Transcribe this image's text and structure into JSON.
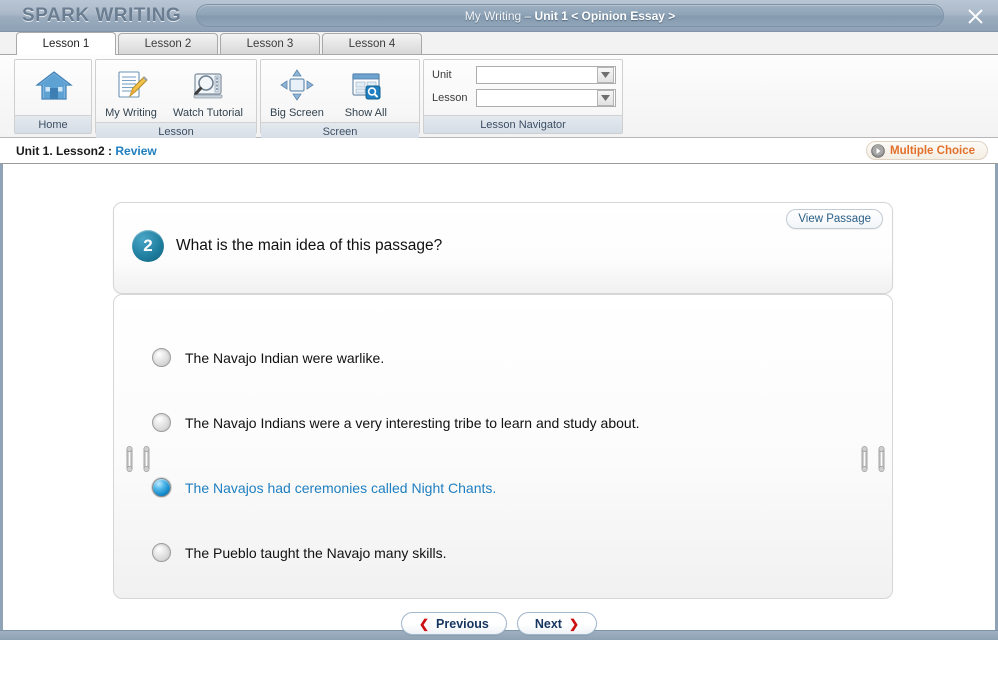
{
  "titlebar": {
    "brand": "SPARK WRITING",
    "title_prefix": "My Writing",
    "title_separator": "–",
    "title_main": "Unit 1 < Opinion Essay >",
    "close_icon": "close-icon"
  },
  "tabs": [
    {
      "label": "Lesson 1",
      "active": true
    },
    {
      "label": "Lesson 2",
      "active": false
    },
    {
      "label": "Lesson 3",
      "active": false
    },
    {
      "label": "Lesson 4",
      "active": false
    }
  ],
  "ribbon": {
    "groups": [
      {
        "label": "Home",
        "commands": [
          {
            "caption": "Home",
            "icon": "house-icon"
          }
        ]
      },
      {
        "label": "Lesson",
        "commands": [
          {
            "caption": "My Writing",
            "icon": "document-pencil-icon"
          },
          {
            "caption": "Watch Tutorial",
            "icon": "video-magnifier-icon"
          }
        ]
      },
      {
        "label": "Screen",
        "commands": [
          {
            "caption": "Big Screen",
            "icon": "resize-arrows-icon"
          },
          {
            "caption": "Show All",
            "icon": "window-search-icon"
          }
        ]
      },
      {
        "label": "Lesson Navigator",
        "selects": [
          {
            "label": "Unit",
            "value": "",
            "placeholder": ""
          },
          {
            "label": "Lesson",
            "value": "",
            "placeholder": ""
          }
        ]
      }
    ]
  },
  "breadcrumb": {
    "path": "Unit 1. Lesson2 : ",
    "current": "Review",
    "badge_label": "Multiple Choice",
    "badge_icon": "arrow-circle-right-icon"
  },
  "question": {
    "number": "2",
    "text": "What is the main idea of this passage?",
    "view_passage_label": "View Passage"
  },
  "options": [
    {
      "text": "The Navajo Indian were warlike.",
      "selected": false
    },
    {
      "text": "The Navajo Indians were a very interesting tribe to learn and study about.",
      "selected": false
    },
    {
      "text": "The Navajos had ceremonies called Night Chants.",
      "selected": true
    },
    {
      "text": "The Pueblo taught the Navajo many skills.",
      "selected": false
    }
  ],
  "navigation": {
    "previous_label": "Previous",
    "next_label": "Next",
    "prev_chevron": "chevron-left-icon",
    "next_chevron": "chevron-right-icon"
  },
  "colors": {
    "accent_blue": "#1f7fc0",
    "badge_orange": "#e2702a",
    "chevron_red": "#cc1111",
    "titlebar": "#8fa2b6",
    "question_badge": "#1f7e9e"
  }
}
